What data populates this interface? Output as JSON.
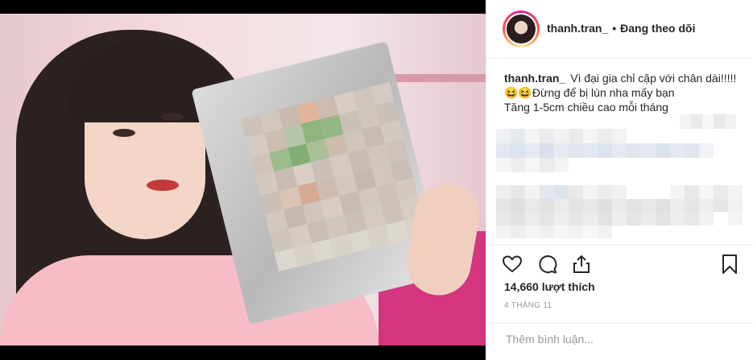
{
  "post": {
    "username": "thanh.tran_",
    "separator": "•",
    "follow_label": "Đang theo dõi",
    "caption_lines": [
      "Vì đại gia chỉ cặp với chân dài!!!!!",
      "😆😆Đừng để bị lùn nha mấy bạn",
      "Tăng 1-5cm chiều cao mỗi tháng"
    ],
    "likes": "14,660 lượt thích",
    "date": "4 THÁNG 11"
  },
  "comment": {
    "placeholder": "Thêm bình luận..."
  },
  "icons": [
    "heart-icon",
    "comment-icon",
    "share-icon",
    "bookmark-icon"
  ],
  "colors": {
    "text": "#262626",
    "muted": "#999999",
    "border": "#efefef"
  }
}
